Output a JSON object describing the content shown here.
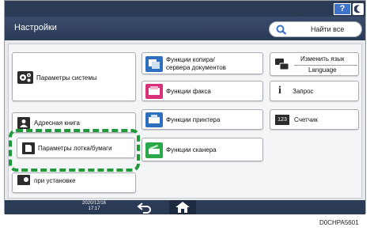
{
  "topbar": {
    "help_label": "?"
  },
  "header": {
    "title": "Настройки",
    "search_label": "Найти все"
  },
  "tiles": {
    "system": "Параметры системы",
    "address": "Адресная книга",
    "tray": "Параметры лотка/бумаги",
    "install": "при установке",
    "copier": "Функции копира/\nсервера документов",
    "fax": "Функции факса",
    "printer": "Функции принтера",
    "scanner": "Функции сканера",
    "lang_top": "Изменить язык",
    "lang_bottom": "Language",
    "inquiry": "Запрос",
    "counter": "Счетчик",
    "counter_icon_text": "123"
  },
  "status": {
    "date": "2020/12/16",
    "time": "17:17"
  },
  "image_id": "D0CHPA5601",
  "colors": {
    "header": "#2b3a55",
    "highlight": "#1f9a3a",
    "help_button": "#3f73c9"
  }
}
